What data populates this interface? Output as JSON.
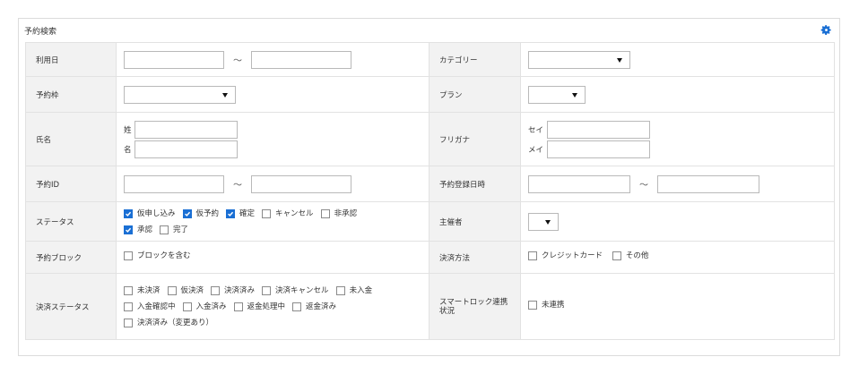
{
  "panel": {
    "title": "予約検索"
  },
  "rows": {
    "use_date": {
      "label": "利用日",
      "tilde": "～"
    },
    "category": {
      "label": "カテゴリー"
    },
    "slot": {
      "label": "予約枠"
    },
    "plan": {
      "label": "プラン"
    },
    "name": {
      "label": "氏名",
      "sei": "姓",
      "mei": "名"
    },
    "furigana": {
      "label": "フリガナ",
      "sei": "セイ",
      "mei": "メイ"
    },
    "reservation_id": {
      "label": "予約ID",
      "tilde": "～"
    },
    "registered_at": {
      "label": "予約登録日時",
      "tilde": "～"
    },
    "status": {
      "label": "ステータス",
      "options": [
        {
          "label": "仮申し込み",
          "checked": true
        },
        {
          "label": "仮予約",
          "checked": true
        },
        {
          "label": "確定",
          "checked": true
        },
        {
          "label": "キャンセル",
          "checked": false
        },
        {
          "label": "非承認",
          "checked": false
        },
        {
          "label": "承認",
          "checked": true
        },
        {
          "label": "完了",
          "checked": false
        }
      ]
    },
    "organizer": {
      "label": "主催者"
    },
    "block": {
      "label": "予約ブロック",
      "options": [
        {
          "label": "ブロックを含む",
          "checked": false
        }
      ]
    },
    "payment_method": {
      "label": "決済方法",
      "options": [
        {
          "label": "クレジットカード",
          "checked": false
        },
        {
          "label": "その他",
          "checked": false
        }
      ]
    },
    "payment_status": {
      "label": "決済ステータス",
      "options": [
        {
          "label": "未決済",
          "checked": false
        },
        {
          "label": "仮決済",
          "checked": false
        },
        {
          "label": "決済済み",
          "checked": false
        },
        {
          "label": "決済キャンセル",
          "checked": false
        },
        {
          "label": "未入金",
          "checked": false
        },
        {
          "label": "入金確認中",
          "checked": false
        },
        {
          "label": "入金済み",
          "checked": false
        },
        {
          "label": "返金処理中",
          "checked": false
        },
        {
          "label": "返金済み",
          "checked": false
        },
        {
          "label": "決済済み（変更あり）",
          "checked": false
        }
      ]
    },
    "smartlock": {
      "label": "スマートロック連携状況",
      "options": [
        {
          "label": "未連携",
          "checked": false
        }
      ]
    }
  },
  "colors": {
    "accent": "#1a6fd4",
    "label_bg": "#f2f2f2",
    "border": "#e2e2e2"
  },
  "icons": {
    "settings": "gear-icon",
    "check": "check-icon"
  }
}
